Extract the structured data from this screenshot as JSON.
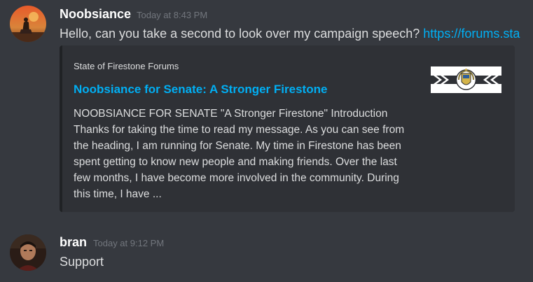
{
  "messages": [
    {
      "username": "Noobsiance",
      "timestamp": "Today at 8:43 PM",
      "text": "Hello, can you take a second to look over my campaign speech? ",
      "link": "https://forums.sta",
      "embed": {
        "provider": "State of Firestone Forums",
        "title": "Noobsiance for Senate: A Stronger Firestone",
        "description": "NOOBSIANCE FOR SENATE \"A Stronger Firestone\" Introduction Thanks for taking the time to read my message. As you can see from the heading, I am running for Senate. My time in Firestone has been spent getting to know new people and making friends. Over the last few months, I have become more involved in the community. During this time, I have ...",
        "thumbnail_icon": "firestone-emblem-icon"
      },
      "avatar_icon": "noobsiance-avatar-icon"
    },
    {
      "username": "bran",
      "timestamp": "Today at 9:12 PM",
      "text": "Support",
      "avatar_icon": "bran-avatar-icon"
    }
  ],
  "colors": {
    "background": "#36393f",
    "embed_background": "#2f3136",
    "link": "#00aff4",
    "text": "#dcddde",
    "timestamp": "#72767d"
  }
}
